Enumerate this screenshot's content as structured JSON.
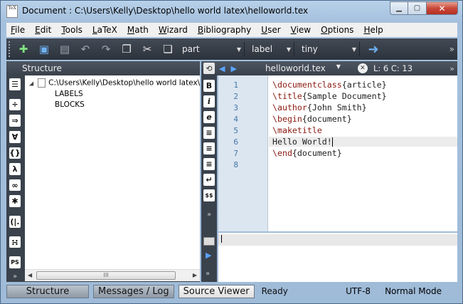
{
  "window": {
    "title": "Document : C:\\Users\\Kelly\\Desktop\\hello world latex\\helloworld.tex",
    "app_icon_text": "TeX",
    "buttons": {
      "minimize": "▁",
      "maximize": "▢",
      "close": "✕"
    }
  },
  "menubar": [
    "File",
    "Edit",
    "Tools",
    "LaTeX",
    "Math",
    "Wizard",
    "Bibliography",
    "User",
    "View",
    "Options",
    "Help"
  ],
  "toolbar": {
    "buttons": [
      {
        "icon": "new-file-icon",
        "glyph": "✚"
      },
      {
        "icon": "save-icon",
        "glyph": "▣"
      },
      {
        "icon": "save-all-icon",
        "glyph": "▤"
      },
      {
        "icon": "undo-icon",
        "glyph": "↶"
      },
      {
        "icon": "redo-icon",
        "glyph": "↷"
      },
      {
        "icon": "copy-icon",
        "glyph": "❐"
      },
      {
        "icon": "cut-icon",
        "glyph": "✂"
      },
      {
        "icon": "paste-icon",
        "glyph": "❏"
      }
    ],
    "combos": [
      "part",
      "label",
      "tiny"
    ],
    "go_icon": "➜",
    "more": "»"
  },
  "structure": {
    "header": "Structure",
    "root_path": "C:\\Users\\Kelly\\Desktop\\hello world latex\\h",
    "children": [
      "LABELS",
      "BLOCKS"
    ],
    "tools": [
      "☰",
      "÷",
      "⇒",
      "∀",
      "{}",
      "λ",
      "∞",
      "✱",
      "(|.",
      "∺",
      "PS"
    ],
    "scroll_thumb": "III"
  },
  "editor": {
    "filename": "helloworld.tex",
    "position": "L: 6 C: 13",
    "tools": [
      "B",
      "i",
      "e",
      "≡",
      "≡",
      "≡",
      "↵",
      "$$"
    ],
    "lines": [
      {
        "num": "1",
        "cmd": "\\documentclass",
        "arg": "{article}"
      },
      {
        "num": "2",
        "cmd": "\\title",
        "arg": "{Sample Document}"
      },
      {
        "num": "3",
        "cmd": "\\author",
        "arg": "{John Smith}"
      },
      {
        "num": "4",
        "cmd": "\\begin",
        "arg": "{document}"
      },
      {
        "num": "5",
        "cmd": "\\maketitle",
        "arg": ""
      },
      {
        "num": "6",
        "cmd": "",
        "arg": "Hello World!"
      },
      {
        "num": "7",
        "cmd": "\\end",
        "arg": "{document}"
      },
      {
        "num": "8",
        "cmd": "",
        "arg": ""
      }
    ],
    "current_line": 6
  },
  "statusbar": {
    "tabs": [
      "Structure",
      "Messages / Log",
      "Source Viewer"
    ],
    "active_tab": "Source Viewer",
    "status": "Ready",
    "encoding": "UTF-8",
    "mode": "Normal Mode"
  }
}
